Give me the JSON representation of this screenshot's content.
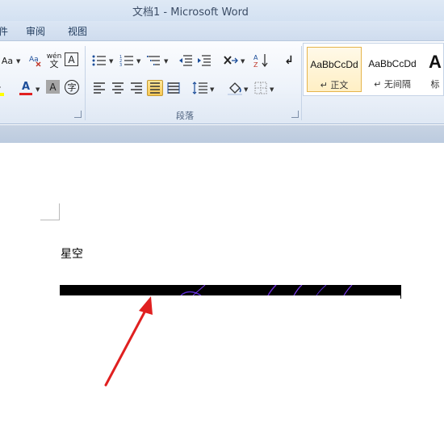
{
  "window": {
    "title": "文档1 - Microsoft Word"
  },
  "tabs": [
    {
      "label": "件"
    },
    {
      "label": "审阅"
    },
    {
      "label": "视图"
    }
  ],
  "ribbon": {
    "font_group": {
      "change_case": "Aa",
      "phonetic_guide": "wén",
      "character_border": "A",
      "font_color": "A",
      "character_shading": "A",
      "enclosed_character": "字"
    },
    "paragraph_group": {
      "label": "段落"
    },
    "styles": [
      {
        "sample": "AaBbCcDd",
        "name": "↵ 正文",
        "selected": true
      },
      {
        "sample": "AaBbCcDd",
        "name": "↵ 无间隔",
        "selected": false
      },
      {
        "sample": "A",
        "name": "标",
        "selected": false
      }
    ]
  },
  "document": {
    "text_line": "星空"
  },
  "colors": {
    "ribbon_bg": "#eef3fa",
    "active_button": "#f7c955",
    "arrow": "#e02020",
    "image_bar": "#000000",
    "image_glow": "#6a2bd6"
  },
  "icons": [
    "change-case-icon",
    "phonetic-guide-icon",
    "character-border-icon",
    "highlight-icon",
    "font-color-icon",
    "character-shading-icon",
    "enclosed-character-icon",
    "bullets-icon",
    "numbering-icon",
    "multilevel-list-icon",
    "decrease-indent-icon",
    "increase-indent-icon",
    "chinese-layout-icon",
    "sort-icon",
    "show-marks-icon",
    "align-left-icon",
    "center-icon",
    "align-right-icon",
    "justify-icon",
    "distributed-icon",
    "line-spacing-icon",
    "shading-icon",
    "borders-icon",
    "red-arrow-icon"
  ]
}
